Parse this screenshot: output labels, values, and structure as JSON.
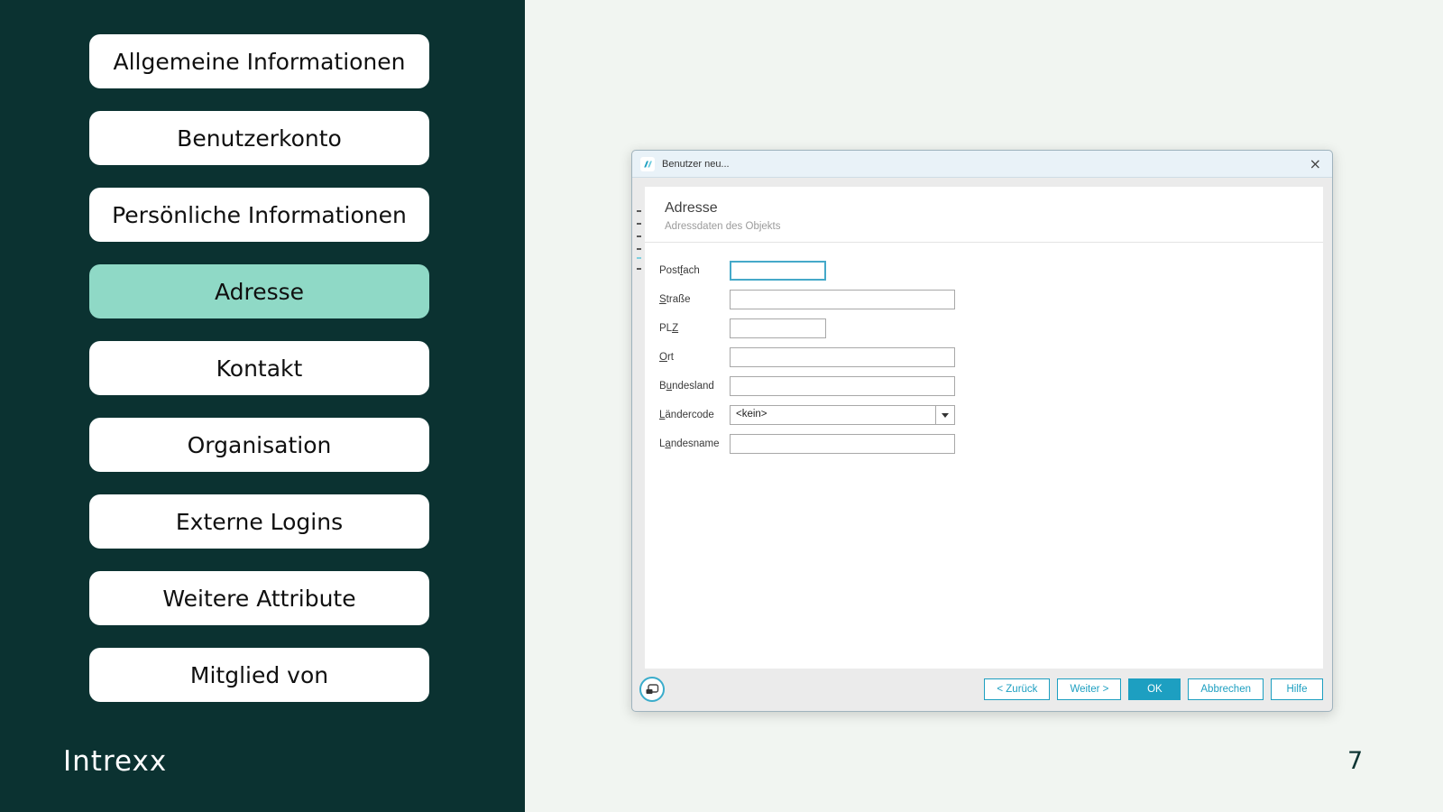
{
  "colors": {
    "sidebar_background": "#0b3231",
    "active_item_highlight": "#8fd9c6",
    "slide_background": "#f1f5f1",
    "dialog_accent_teal": "#1d9fc1",
    "focused_input_border": "#45a9c9"
  },
  "slide": {
    "logo_text": "Intrexx",
    "page_number": "7"
  },
  "sidebar": {
    "items": [
      {
        "name": "sidebar-item-allgemeine-informationen",
        "label": "Allgemeine Informationen",
        "active": false
      },
      {
        "name": "sidebar-item-benutzerkonto",
        "label": "Benutzerkonto",
        "active": false
      },
      {
        "name": "sidebar-item-persoenliche-informationen",
        "label": "Persönliche Informationen",
        "active": false
      },
      {
        "name": "sidebar-item-adresse",
        "label": "Adresse",
        "active": true
      },
      {
        "name": "sidebar-item-kontakt",
        "label": "Kontakt",
        "active": false
      },
      {
        "name": "sidebar-item-organisation",
        "label": "Organisation",
        "active": false
      },
      {
        "name": "sidebar-item-externe-logins",
        "label": "Externe Logins",
        "active": false
      },
      {
        "name": "sidebar-item-weitere-attribute",
        "label": "Weitere Attribute",
        "active": false
      },
      {
        "name": "sidebar-item-mitglied-von",
        "label": "Mitglied von",
        "active": false
      }
    ]
  },
  "dialog": {
    "title": "Benutzer neu...",
    "close_glyph": "×",
    "app_icon": "intrexx-slashes-icon",
    "header": {
      "title": "Adresse",
      "subtitle": "Adressdaten des Objekts"
    },
    "fields": [
      {
        "name": "postfach-input",
        "pre": "Post",
        "key": "f",
        "post": "ach",
        "type": "text",
        "size": "short",
        "value": "",
        "focused": true
      },
      {
        "name": "strasse-input",
        "pre": "",
        "key": "S",
        "post": "traße",
        "type": "text",
        "size": "long",
        "value": "",
        "focused": false
      },
      {
        "name": "plz-input",
        "pre": "PL",
        "key": "Z",
        "post": "",
        "type": "text",
        "size": "short",
        "value": "",
        "focused": false
      },
      {
        "name": "ort-input",
        "pre": "",
        "key": "O",
        "post": "rt",
        "type": "text",
        "size": "long",
        "value": "",
        "focused": false
      },
      {
        "name": "bundesland-input",
        "pre": "B",
        "key": "u",
        "post": "ndesland",
        "type": "text",
        "size": "long",
        "value": "",
        "focused": false
      },
      {
        "name": "laendercode-select",
        "pre": "",
        "key": "L",
        "post": "ändercode",
        "type": "combo",
        "size": "long",
        "value": "<kein>",
        "focused": false
      },
      {
        "name": "landesname-input",
        "pre": "L",
        "key": "a",
        "post": "ndesname",
        "type": "text",
        "size": "long",
        "value": "",
        "focused": false
      }
    ],
    "footer": {
      "window_icon": "overlapping-windows-icon",
      "buttons": [
        {
          "name": "zurueck-button",
          "label": "< Zurück",
          "primary": false
        },
        {
          "name": "weiter-button",
          "label": "Weiter >",
          "primary": false
        },
        {
          "name": "ok-button",
          "label": "OK",
          "primary": true
        },
        {
          "name": "abbrechen-button",
          "label": "Abbrechen",
          "primary": false
        },
        {
          "name": "hilfe-button",
          "label": "Hilfe",
          "primary": false
        }
      ]
    }
  }
}
